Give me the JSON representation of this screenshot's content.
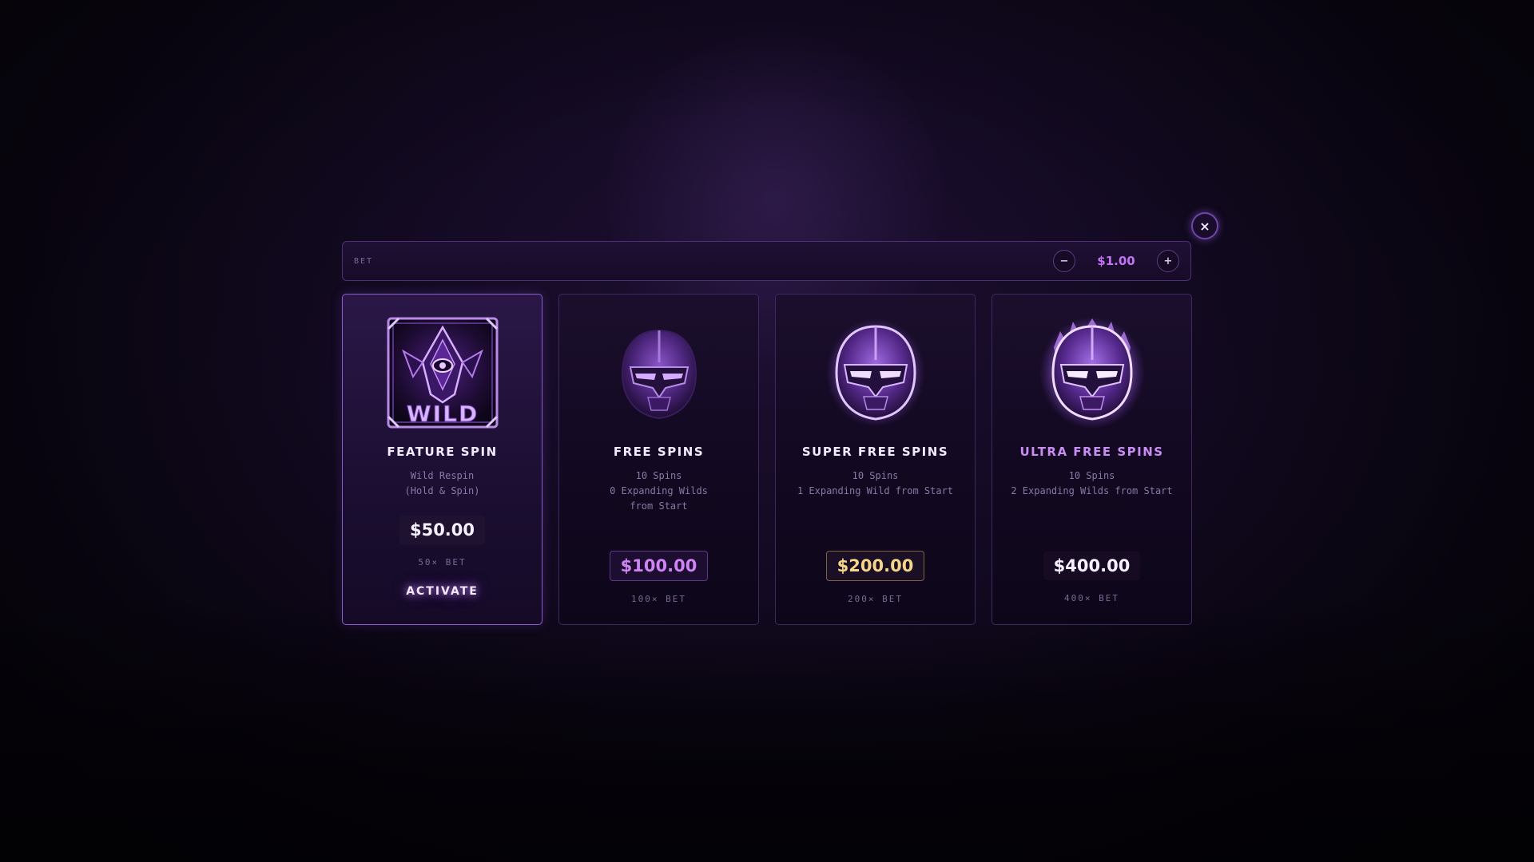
{
  "modal": {
    "close_icon": "close-icon",
    "close_label": "×"
  },
  "bet": {
    "label": "BET",
    "minus_label": "−",
    "plus_label": "+",
    "value": "$1.00"
  },
  "cards": [
    {
      "title": "FEATURE SPIN",
      "description": "Wild Respin\n(Hold & Spin)",
      "price": "$50.00",
      "multiplier": "50× BET",
      "action_label": "ACTIVATE",
      "icon": "wild-symbol-icon",
      "selected": true
    },
    {
      "title": "FREE SPINS",
      "description": "10 Spins\n0 Expanding Wilds\nfrom Start",
      "price": "$100.00",
      "multiplier": "100× BET",
      "icon": "helmet-icon"
    },
    {
      "title": "SUPER FREE SPINS",
      "description": "10 Spins\n1 Expanding Wild from Start",
      "price": "$200.00",
      "multiplier": "200× BET",
      "icon": "glowing-helmet-icon"
    },
    {
      "title": "ULTRA FREE SPINS",
      "description": "10 Spins\n2 Expanding Wilds from Start",
      "price": "$400.00",
      "multiplier": "400× BET",
      "icon": "flaming-helmet-icon"
    }
  ],
  "colors": {
    "accent": "#c274f5",
    "gold": "#f5d58a",
    "background": "#0b0614",
    "panel": "#1b0f2d"
  }
}
